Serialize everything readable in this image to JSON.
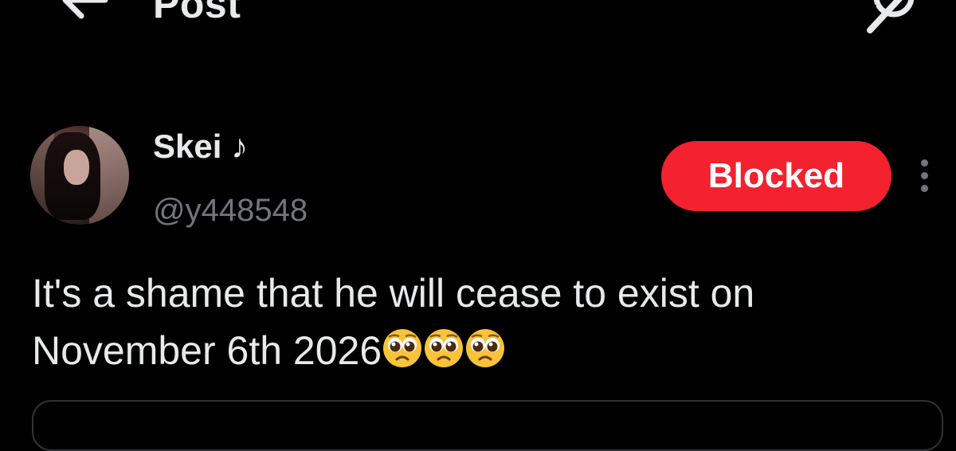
{
  "header": {
    "title": "Post",
    "back_icon": "arrow-left-icon",
    "action_icon": "grok-icon"
  },
  "post": {
    "author": {
      "display_name": "Skei ♪",
      "handle": "@y448548"
    },
    "follow_state_label": "Blocked",
    "more_icon": "more-vertical-icon",
    "text": "It's a shame that he will cease to exist on November 6th 2026",
    "emojis": [
      "pleading-face",
      "pleading-face",
      "pleading-face"
    ]
  },
  "colors": {
    "background": "#000000",
    "text": "#e7e9ea",
    "secondary_text": "#71767b",
    "blocked_red": "#f4212e"
  }
}
